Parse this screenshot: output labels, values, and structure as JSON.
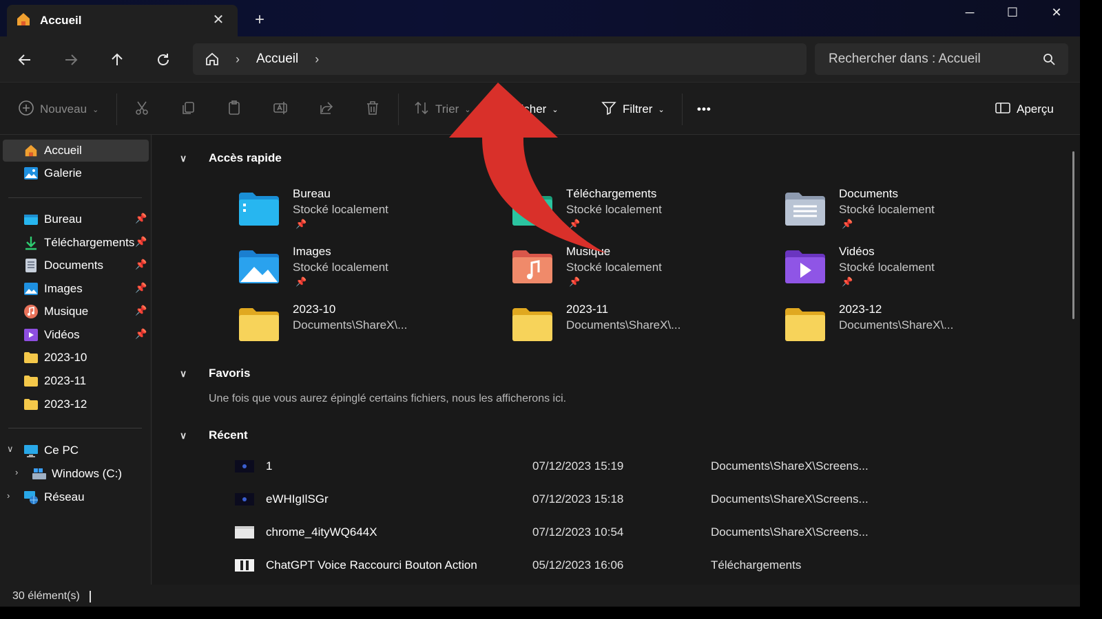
{
  "window": {
    "tab_title": "Accueil",
    "controls": {
      "minimize": "─",
      "maximize": "☐",
      "close": "✕"
    },
    "new_tab": "+"
  },
  "navbar": {
    "breadcrumb": [
      "Accueil"
    ],
    "search_placeholder": "Rechercher dans : Accueil"
  },
  "toolbar": {
    "new_label": "Nouveau",
    "sort_label": "Trier",
    "view_label": "Afficher",
    "filter_label": "Filtrer",
    "more_label": "•••",
    "preview_label": "Aperçu"
  },
  "sidebar": {
    "top": [
      {
        "label": "Accueil",
        "icon": "home-icon",
        "selected": true
      },
      {
        "label": "Galerie",
        "icon": "gallery-icon"
      }
    ],
    "pinned": [
      {
        "label": "Bureau",
        "icon": "desktop-folder-icon"
      },
      {
        "label": "Téléchargements",
        "icon": "download-icon"
      },
      {
        "label": "Documents",
        "icon": "documents-folder-icon"
      },
      {
        "label": "Images",
        "icon": "pictures-folder-icon"
      },
      {
        "label": "Musique",
        "icon": "music-folder-icon"
      },
      {
        "label": "Vidéos",
        "icon": "videos-folder-icon"
      },
      {
        "label": "2023-10",
        "icon": "folder-icon"
      },
      {
        "label": "2023-11",
        "icon": "folder-icon"
      },
      {
        "label": "2023-12",
        "icon": "folder-icon"
      }
    ],
    "pc": {
      "label": "Ce PC"
    },
    "drive": {
      "label": "Windows (C:)"
    },
    "network": {
      "label": "Réseau"
    }
  },
  "main": {
    "quick_access_title": "Accès rapide",
    "quick_access": [
      {
        "name": "Bureau",
        "sub": "Stocké localement",
        "pinned": true,
        "icon": "desktop-folder-icon"
      },
      {
        "name": "Téléchargements",
        "sub": "Stocké localement",
        "pinned": true,
        "icon": "downloads-folder-icon"
      },
      {
        "name": "Documents",
        "sub": "Stocké localement",
        "pinned": true,
        "icon": "documents-folder-icon"
      },
      {
        "name": "Images",
        "sub": "Stocké localement",
        "pinned": true,
        "icon": "pictures-folder-icon"
      },
      {
        "name": "Musique",
        "sub": "Stocké localement",
        "pinned": true,
        "icon": "music-folder-icon"
      },
      {
        "name": "Vidéos",
        "sub": "Stocké localement",
        "pinned": true,
        "icon": "videos-folder-icon"
      },
      {
        "name": "2023-10",
        "sub": "Documents\\ShareX\\...",
        "pinned": false,
        "icon": "folder-icon"
      },
      {
        "name": "2023-11",
        "sub": "Documents\\ShareX\\...",
        "pinned": false,
        "icon": "folder-icon"
      },
      {
        "name": "2023-12",
        "sub": "Documents\\ShareX\\...",
        "pinned": false,
        "icon": "folder-icon"
      }
    ],
    "favorites_title": "Favoris",
    "favorites_empty": "Une fois que vous aurez épinglé certains fichiers, nous les afficherons ici.",
    "recent_title": "Récent",
    "recent": [
      {
        "name": "1",
        "date": "07/12/2023 15:19",
        "path": "Documents\\ShareX\\Screens..."
      },
      {
        "name": "eWHIgIlSGr",
        "date": "07/12/2023 15:18",
        "path": "Documents\\ShareX\\Screens..."
      },
      {
        "name": "chrome_4ityWQ644X",
        "date": "07/12/2023 10:54",
        "path": "Documents\\ShareX\\Screens..."
      },
      {
        "name": "ChatGPT Voice Raccourci Bouton Action",
        "date": "05/12/2023 16:06",
        "path": "Téléchargements"
      }
    ]
  },
  "status": {
    "count": "30 élément(s)"
  },
  "colors": {
    "annotation_arrow": "#d9302a",
    "folder_yellow": "#f4c84a",
    "accent_blue": "#1fa3e6"
  }
}
